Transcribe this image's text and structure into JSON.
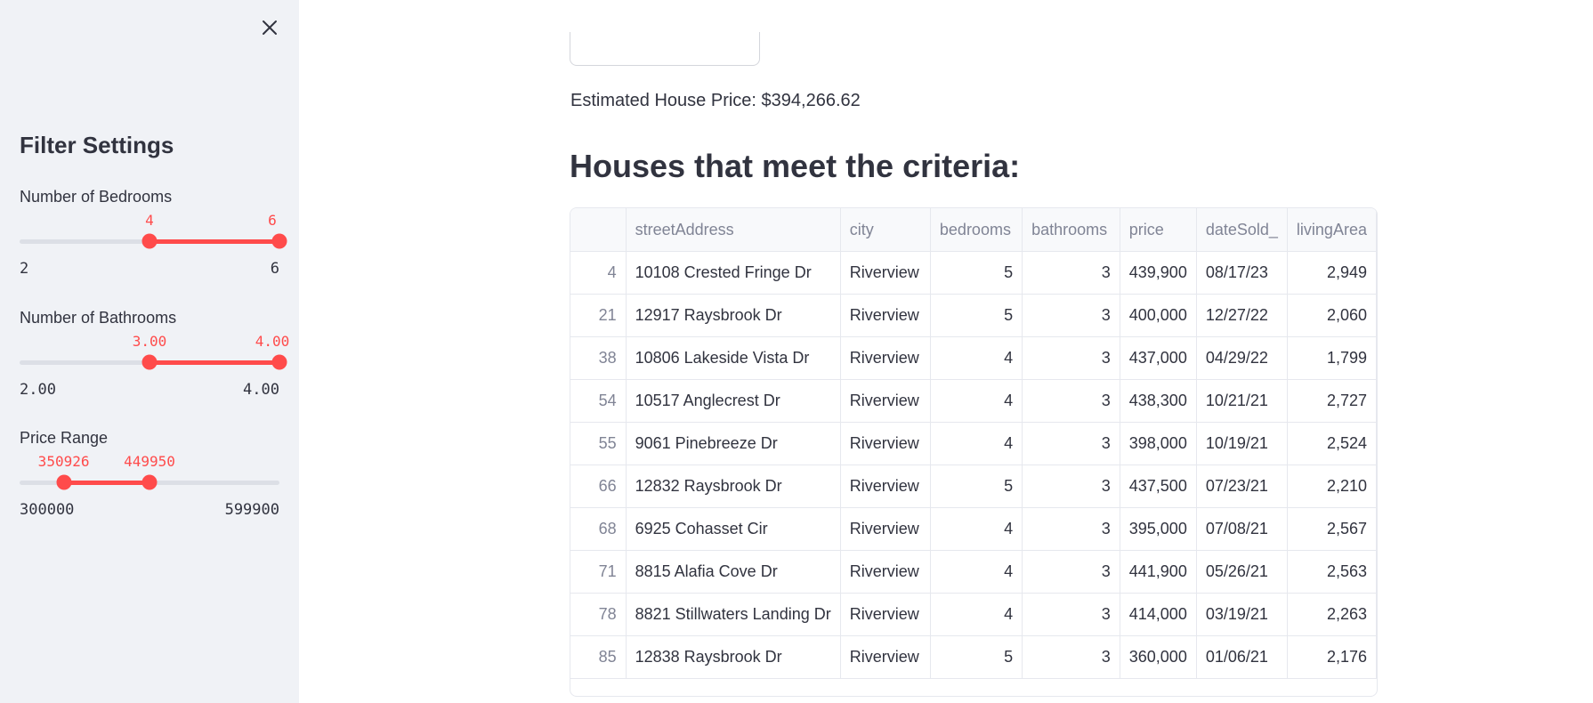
{
  "sidebar": {
    "title": "Filter Settings",
    "bedrooms": {
      "label": "Number of Bedrooms",
      "low": "4",
      "high": "6",
      "min": "2",
      "max": "6",
      "low_frac": 0.5,
      "high_frac": 1.0
    },
    "bathrooms": {
      "label": "Number of Bathrooms",
      "low": "3.00",
      "high": "4.00",
      "min": "2.00",
      "max": "4.00",
      "low_frac": 0.5,
      "high_frac": 1.0
    },
    "price": {
      "label": "Price Range",
      "low": "350926",
      "high": "449950",
      "min": "300000",
      "max": "599900",
      "low_frac": 0.1698,
      "high_frac": 0.5
    }
  },
  "main": {
    "estimate": "Estimated House Price: $394,266.62",
    "heading": "Houses that meet the criteria:"
  },
  "table": {
    "columns": [
      "",
      "streetAddress",
      "city",
      "bedrooms",
      "bathrooms",
      "price",
      "dateSold_",
      "livingArea"
    ],
    "rows": [
      [
        "4",
        "10108 Crested Fringe Dr",
        "Riverview",
        "5",
        "3",
        "439,900",
        "08/17/23",
        "2,949"
      ],
      [
        "21",
        "12917 Raysbrook Dr",
        "Riverview",
        "5",
        "3",
        "400,000",
        "12/27/22",
        "2,060"
      ],
      [
        "38",
        "10806 Lakeside Vista Dr",
        "Riverview",
        "4",
        "3",
        "437,000",
        "04/29/22",
        "1,799"
      ],
      [
        "54",
        "10517 Anglecrest Dr",
        "Riverview",
        "4",
        "3",
        "438,300",
        "10/21/21",
        "2,727"
      ],
      [
        "55",
        "9061 Pinebreeze Dr",
        "Riverview",
        "4",
        "3",
        "398,000",
        "10/19/21",
        "2,524"
      ],
      [
        "66",
        "12832 Raysbrook Dr",
        "Riverview",
        "5",
        "3",
        "437,500",
        "07/23/21",
        "2,210"
      ],
      [
        "68",
        "6925 Cohasset Cir",
        "Riverview",
        "4",
        "3",
        "395,000",
        "07/08/21",
        "2,567"
      ],
      [
        "71",
        "8815 Alafia Cove Dr",
        "Riverview",
        "4",
        "3",
        "441,900",
        "05/26/21",
        "2,563"
      ],
      [
        "78",
        "8821 Stillwaters Landing Dr",
        "Riverview",
        "4",
        "3",
        "414,000",
        "03/19/21",
        "2,263"
      ],
      [
        "85",
        "12838 Raysbrook Dr",
        "Riverview",
        "5",
        "3",
        "360,000",
        "01/06/21",
        "2,176"
      ]
    ]
  },
  "colors": {
    "accent": "#ff4b4b",
    "sidebar_bg": "#f0f2f6"
  },
  "icons": {
    "close": "close-icon"
  }
}
